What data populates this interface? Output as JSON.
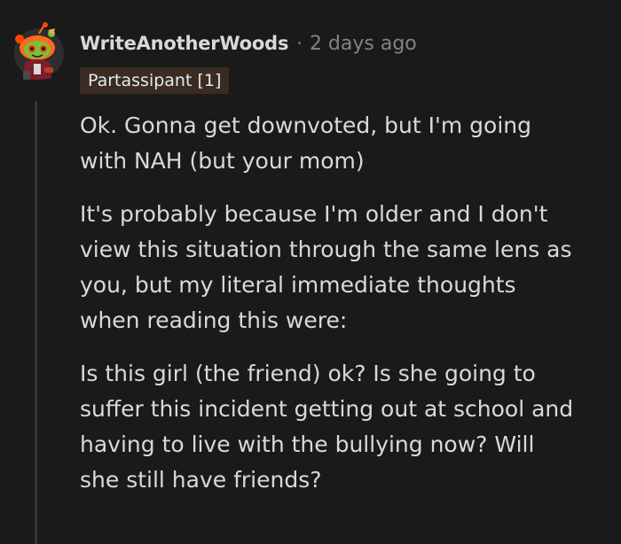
{
  "comment": {
    "username": "WriteAnotherWoods",
    "separator": "·",
    "timestamp": "2 days ago",
    "flair": "Partassipant [1]",
    "paragraphs": [
      [
        "Ok. Gonna get downvoted, but I'm going",
        "with NAH (but your mom)"
      ],
      [
        "It's probably because I'm older and I don't",
        "view this situation through the same lens as",
        "you, but my literal immediate thoughts",
        "when reading this were:"
      ],
      [
        "Is this girl (the friend) ok? Is she going to",
        "suffer this incident getting out at school and",
        "having to live with the bullying now? Will",
        "she still have friends?"
      ]
    ]
  },
  "colors": {
    "background": "#1a1a1b",
    "text": "#d7dadc",
    "muted": "#818384",
    "flair_bg": "#3a2c25",
    "avatar_orange": "#ff4500",
    "avatar_green": "#7bbf3a"
  },
  "icons": {
    "avatar": "snoo-avatar-icon"
  }
}
